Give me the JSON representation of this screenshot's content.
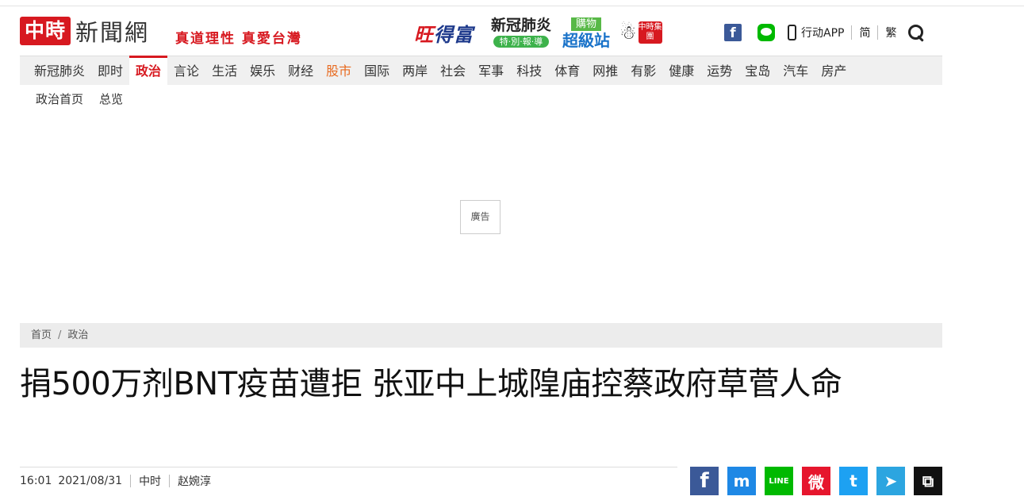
{
  "header": {
    "logo_mark": "中時",
    "logo_name": "新聞網",
    "slogan": "真道理性 真愛台灣",
    "partners": {
      "want_a": "旺",
      "want_b": "得富",
      "covid_title": "新冠肺炎",
      "covid_sub": "特·別·報·導",
      "shop_top": "購物",
      "shop_bottom": "超級站",
      "group_badge": "中時集團"
    },
    "facebook": "f",
    "line": "LINE",
    "app_label": "行动APP",
    "lang_simplified": "简",
    "lang_traditional": "繁"
  },
  "nav": {
    "items": [
      "新冠肺炎",
      "即时",
      "政治",
      "言论",
      "生活",
      "娱乐",
      "财经",
      "股市",
      "国际",
      "两岸",
      "社会",
      "军事",
      "科技",
      "体育",
      "网推",
      "有影",
      "健康",
      "运势",
      "宝岛",
      "汽车",
      "房产"
    ],
    "active": "政治"
  },
  "subnav": {
    "items": [
      "政治首页",
      "总览"
    ]
  },
  "ad": {
    "label": "廣告"
  },
  "breadcrumb": {
    "home": "首页",
    "separator": "/",
    "current": "政治"
  },
  "article": {
    "title": "捐500万剂BNT疫苗遭拒 张亚中上城隍庙控蔡政府草菅人命",
    "time": "16:01",
    "date": "2021/08/31",
    "source": "中时",
    "author": "赵婉淳"
  },
  "share": {
    "facebook": "f",
    "messenger": "m",
    "line": "LINE",
    "weibo": "微",
    "twitter": "t",
    "telegram": "➤",
    "copy": "⧉"
  }
}
